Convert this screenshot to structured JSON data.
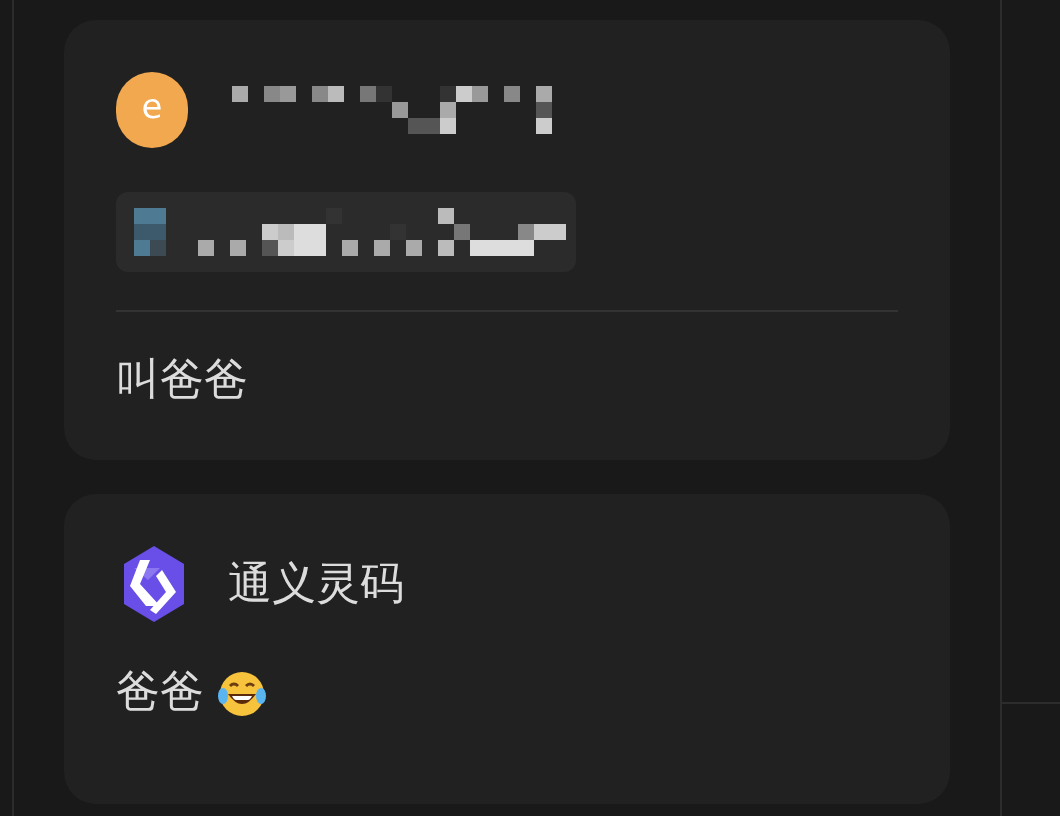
{
  "messages": [
    {
      "kind": "user",
      "avatar_letter": "e",
      "text": "叫爸爸"
    },
    {
      "kind": "assistant",
      "sender": "通义灵码",
      "text": "爸爸"
    }
  ]
}
